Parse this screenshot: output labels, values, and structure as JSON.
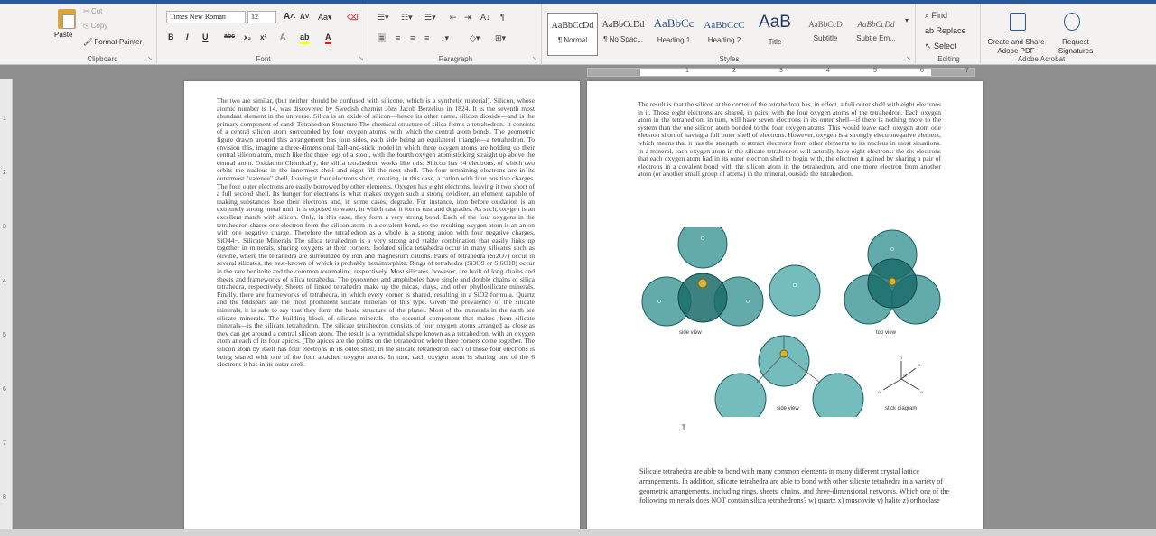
{
  "clipboard": {
    "paste": "Paste",
    "cut": "Cut",
    "copy": "Copy",
    "format_painter": "Format Painter",
    "label": "Clipboard"
  },
  "font": {
    "name": "Times New Roman",
    "size": "12",
    "label": "Font"
  },
  "paragraph": {
    "label": "Paragraph"
  },
  "styles": {
    "label": "Styles",
    "items": [
      {
        "sample": "AaBbCcDd",
        "name": "¶ Normal"
      },
      {
        "sample": "AaBbCcDd",
        "name": "¶ No Spac..."
      },
      {
        "sample": "AaBbCc",
        "name": "Heading 1"
      },
      {
        "sample": "AaBbCcC",
        "name": "Heading 2"
      },
      {
        "sample": "AaB",
        "name": "Title"
      },
      {
        "sample": "AaBbCcD",
        "name": "Subtitle"
      },
      {
        "sample": "AaBbCcDd",
        "name": "Subtle Em..."
      }
    ]
  },
  "editing": {
    "find": "Find",
    "replace": "Replace",
    "select": "Select",
    "label": "Editing"
  },
  "acrobat": {
    "create_share": "Create and Share Adobe PDF",
    "request_sig": "Request Signatures",
    "label": "Adobe Acrobat"
  },
  "ruler": [
    "1",
    "2",
    "3",
    "4",
    "5",
    "6",
    "7"
  ],
  "ruler_v": [
    "1",
    "2",
    "3",
    "4",
    "5",
    "6",
    "7",
    "8"
  ],
  "left_page_text": "The two are similar, (but neither should be confused with silicone, which is a synthetic material). Silicon, whose atomic number is 14, was discovered by Swedish chemist Jöns Jacob Berzelius in 1824. It is the seventh most abundant element in the universe. Silica is an oxide of silicon—hence its other name, silicon dioxide—and is the primary component of sand. Tetrahedron Structure The chemical structure of silica forms a tetrahedron. It consists of a central silicon atom surrounded by four oxygen atoms, with which the central atom bonds. The geometric figure drawn around this arrangement has four sides, each side being an equilateral triangle—a tetrahedron. To envision this, imagine a three-dimensional ball-and-stick model in which three oxygen atoms are holding up their central silicon atom, much like the three legs of a stool, with the fourth oxygen atom sticking straight up above the central atom. Oxidation Chemically, the silica tetrahedron works like this: Silicon has 14 electrons, of which two orbits the nucleus in the innermost shell and eight fill the next shell. The four remaining electrons are in its outermost \"valence\" shell, leaving it four electrons short, creating, in this case, a cation with four positive charges. The four outer electrons are easily borrowed by other elements. Oxygen has eight electrons, leaving it two short of a full second shell. Its hunger for electrons is what makes oxygen such a strong oxidizer, an element capable of making substances lose their electrons and, in some cases, degrade. For instance, iron before oxidation is an extremely strong metal until it is exposed to water, in which case it forms rust and degrades. As such, oxygen is an excellent match with silicon. Only, in this case, they form a very strong bond. Each of the four oxygens in the tetrahedron shares one electron from the silicon atom in a covalent bond, so the resulting oxygen atom is an anion with one negative charge. Therefore the tetrahedron as a whole is a strong anion with four negative charges, SiO44−. Silicate Minerals The silica tetrahedron is a very strong and stable combination that easily links up together in minerals, sharing oxygens at their corners. Isolated silica tetrahedra occur in many silicates such as olivine, where the tetrahedra are surrounded by iron and magnesium cations. Pairs of tetrahedra (Si2O7) occur in several silicates, the best-known of which is probably hemimorphite. Rings of tetrahedra (Si3O9 or Si6O18) occur in the rare benitoite and the common tourmaline, respectively. Most silicates, however, are built of long chains and sheets and frameworks of silica tetrahedra. The pyroxenes and amphiboles have single and double chains of silica tetrahedra, respectively. Sheets of linked tetrahedra make up the micas, clays, and other phyllosilicate minerals. Finally, there are frameworks of tetrahedra, in which every corner is shared, resulting in a SiO2 formula. Quartz and the feldspars are the most prominent silicate minerals of this type. Given the prevalence of the silicate minerals, it is safe to say that they form the basic structure of the planet. Most of the minerals in the earth are silicate minerals. The building block of silicate minerals—the essential component that makes them silicate minerals—is the silicate tetrahedron. The silicate tetrahedron consists of four oxygen atoms arranged as close as they can get around a central silicon atom. The result is a pyramidal shape known as a tetrahedron, with an oxygen atom at each of its four apices. (The apices are the points on the tetrahedron where three corners come together. The silicon atom by itself has four electrons in its outer shell. In the silicate tetrahedron each of those four electrons is being shared with one of the four attached oxygen atoms. In turn, each oxygen atom is sharing one of the 6 electrons it has in its outer shell.",
  "right_page_text": "The result is that the silicon at the center of the tetrahedron has, in effect, a full outer shell with eight electrons in it. Those eight electrons are shared, in pairs, with the four oxygen atoms of the tetrahedron. Each oxygen atom in the tetrahedron, in turn, will have seven electrons in its outer shell—if there is nothing more to the system than the one silicon atom bonded to the four oxygen atoms. This would leave each oxygen atom one electron short of having a full outer shell of electrons. However, oxygen is a strongly electronegative element, which means that it has the strength to attract electrons from other elements to its nucleus in most situations. In a mineral, each oxygen atom in the silicate tetrahedron will actually have eight electrons: the six electrons that each oxygen atom had in its outer electron shell to begin with, the electron it gained by sharing a pair of electrons in a covalent bond with the silicon atom in the tetrahedron, and one more electron from another atom (or another small group of atoms) in the mineral, outside the tetrahedron.",
  "diagram": {
    "atom_o": "O",
    "atom_si": "Si",
    "labels": [
      "side view",
      "top view",
      "side view",
      "stick diagram"
    ]
  },
  "question_text": "Silicate tetrahedra are able to bond with many common elements in many different crystal lattice arrangements. In addition, silicate tetrahedra are able to bond with other silicate tetrahedra in a variety of geometric arrangements, including rings, sheets, chains, and three-dimensional networks. Which one of the following minerals does NOT contain silica tetrahedrons? w) quartz x) muscovite y) halite z) orthoclase"
}
